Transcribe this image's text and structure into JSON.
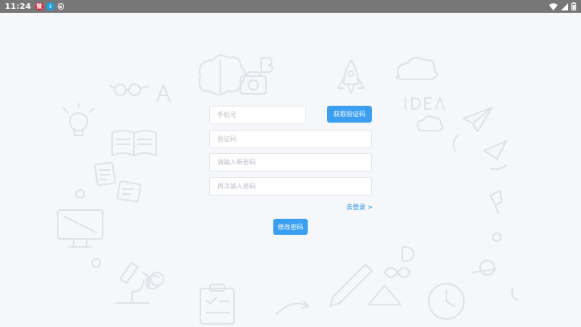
{
  "status_bar": {
    "time": "11:24",
    "left_icons": [
      "weibo-icon",
      "download-icon",
      "record-icon"
    ],
    "right_icons": [
      "wifi-icon",
      "signal-icon",
      "battery-icon"
    ]
  },
  "form": {
    "phone_placeholder": "手机号",
    "get_code_button": "获取验证码",
    "code_placeholder": "验证码",
    "new_password_placeholder": "请输入新密码",
    "confirm_password_placeholder": "再次输入密码",
    "login_link": "去登录 >",
    "submit_button": "修改密码"
  },
  "colors": {
    "accent": "#3a9ff0",
    "link": "#1e90e6",
    "background": "#f5f7fa",
    "status_bar": "#777777"
  }
}
